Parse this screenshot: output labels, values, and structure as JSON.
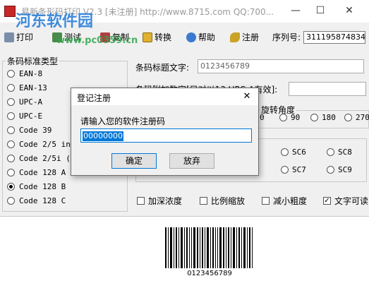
{
  "window": {
    "title": "易新条形码打印 V2.3 [未注册] http://www.8715.com QQ:700...",
    "watermark": "河东软件园",
    "watermark_url": "www.pc0359.cn"
  },
  "toolbar": {
    "items": [
      {
        "label": "打印",
        "icon": "printer-icon"
      },
      {
        "label": "测试",
        "icon": "test-icon"
      },
      {
        "label": "复制",
        "icon": "copy-icon"
      },
      {
        "label": "转换",
        "icon": "convert-icon"
      },
      {
        "label": "帮助",
        "icon": "help-icon"
      },
      {
        "label": "注册",
        "icon": "key-icon"
      }
    ],
    "serial_label": "序列号:",
    "serial_value": "311195874834"
  },
  "barcode_types": {
    "title": "条码标准类型",
    "items": [
      "EAN-8",
      "EAN-13",
      "UPC-A",
      "UPC-E",
      "Code 39",
      "Code 2/5 int",
      "Code 2/5i (F",
      "Code 128 A",
      "Code 128 B",
      "Code 128 C"
    ],
    "selected": "Code 128 B"
  },
  "form": {
    "title_label": "条码标题文字:",
    "title_value": "0123456789",
    "extra_label": "条码附加数字[只对以13 UPC-A有效]:",
    "rotation_label": "旋转角度",
    "rotation_options": [
      "0",
      "90",
      "180",
      "270"
    ],
    "sc_options": [
      "SC6",
      "SC8",
      "SC7",
      "SC9"
    ],
    "checkboxes": [
      {
        "label": "加深浓度",
        "checked": false
      },
      {
        "label": "比例缩放",
        "checked": false
      },
      {
        "label": "减小粗度",
        "checked": false
      },
      {
        "label": "文字可读",
        "checked": true
      }
    ]
  },
  "preview": {
    "barcode_text": "0123456789"
  },
  "dialog": {
    "title": "登记注册",
    "prompt": "请输入您的软件注册码",
    "input_value": "00000000",
    "ok_label": "确定",
    "cancel_label": "放弃"
  },
  "colors": {
    "accent": "#0078d7",
    "watermark_blue": "#2b7fd9",
    "watermark_green": "#2fa44a"
  }
}
